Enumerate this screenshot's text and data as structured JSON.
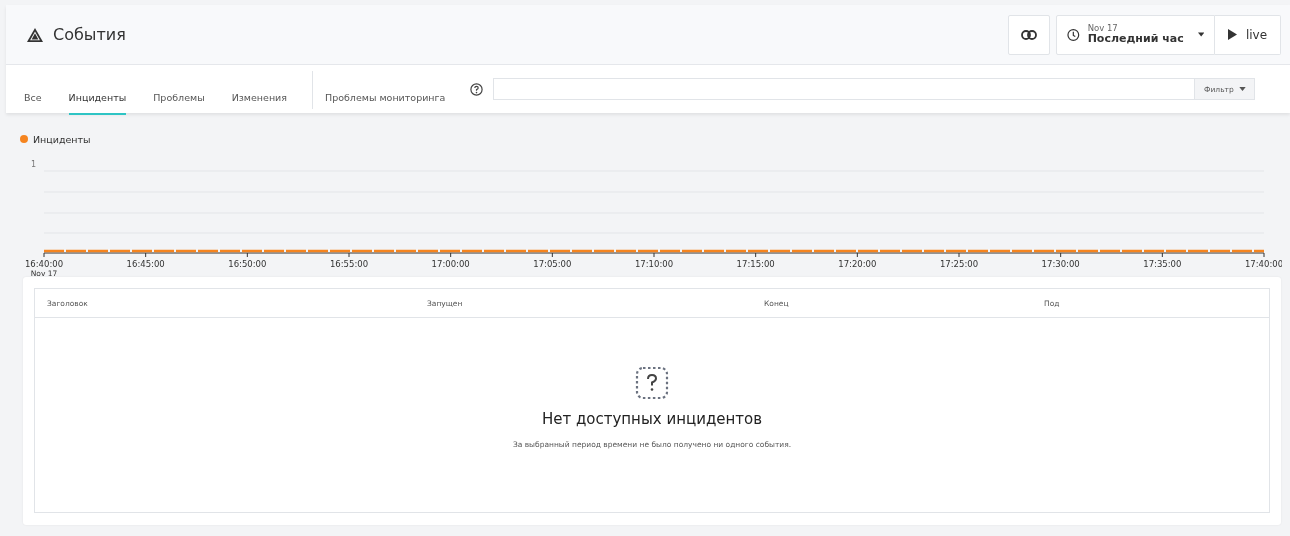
{
  "header": {
    "title": "События",
    "date": "Nov 17",
    "range": "Последний час",
    "live": "live"
  },
  "tabs": [
    {
      "label": "Все",
      "selected": false
    },
    {
      "label": "Инциденты",
      "selected": true
    },
    {
      "label": "Проблемы",
      "selected": false
    },
    {
      "label": "Изменения",
      "selected": false
    },
    {
      "label": "Проблемы мониторинга",
      "selected": false
    }
  ],
  "filter": {
    "button": "Фильтр"
  },
  "chart": {
    "legend": {
      "label": "Инциденты",
      "color": "#f5841f"
    },
    "y_label": "1",
    "time_labels": [
      "16:40:00",
      "16:45:00",
      "16:50:00",
      "16:55:00",
      "17:00:00",
      "17:05:00",
      "17:10:00",
      "17:15:00",
      "17:20:00",
      "17:25:00",
      "17:30:00",
      "17:35:00",
      "17:40:00"
    ],
    "date_label": "Nov 17"
  },
  "table": {
    "columns": [
      "Заголовок",
      "Запущен",
      "Конец",
      "Под"
    ],
    "empty_title": "Нет доступных инцидентов",
    "empty_text": "За выбранный период времени не было получено ни одного события."
  }
}
